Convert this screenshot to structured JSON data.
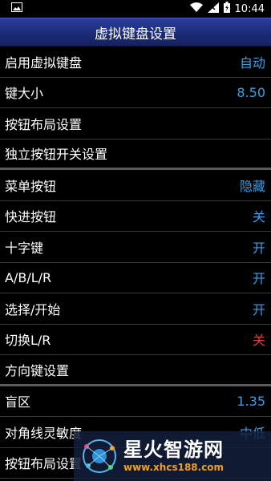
{
  "statusbar": {
    "time": "10:44"
  },
  "header": {
    "title": "虚拟键盘设置"
  },
  "rows": [
    {
      "label": "启用虚拟键盘",
      "value": "自动",
      "value_color": "blue"
    },
    {
      "label": "键大小",
      "value": "8.50",
      "value_color": "blue"
    },
    {
      "label": "按钮布局设置",
      "value": ""
    },
    {
      "label": "独立按钮开关设置",
      "value": ""
    },
    {
      "label": "菜单按钮",
      "value": "隐藏",
      "value_color": "blue"
    },
    {
      "label": "快进按钮",
      "value": "关",
      "value_color": "blue"
    },
    {
      "label": "十字键",
      "value": "开",
      "value_color": "blue"
    },
    {
      "label": "A/B/L/R",
      "value": "开",
      "value_color": "blue"
    },
    {
      "label": "选择/开始",
      "value": "开",
      "value_color": "blue"
    },
    {
      "label": "切换L/R",
      "value": "关",
      "value_color": "red"
    },
    {
      "label": "方向键设置",
      "value": ""
    },
    {
      "label": "盲区",
      "value": "1.35",
      "value_color": "blue"
    },
    {
      "label": "对角线灵敏度",
      "value": "中低",
      "value_color": "blue"
    },
    {
      "label": "按钮布局设置",
      "value": ""
    }
  ],
  "watermark": {
    "title": "星火智游网",
    "url": "www.xhcs188.com"
  },
  "colors": {
    "accent_blue": "#3aa0e8",
    "off_red": "#e0403a",
    "titlebar": "#1c2c78"
  }
}
